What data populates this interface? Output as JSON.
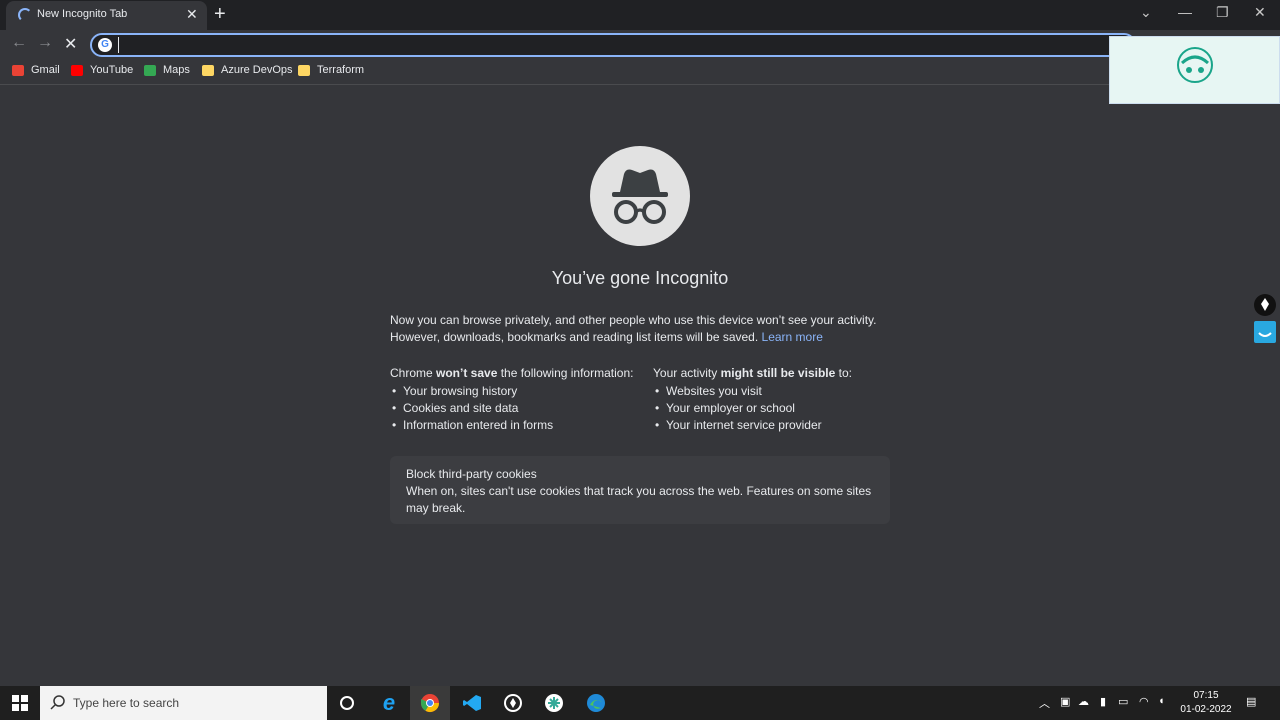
{
  "tab": {
    "title": "New Incognito Tab",
    "close": "✕"
  },
  "newtab": "+",
  "window": {
    "minimize": "—",
    "restore": "❐",
    "close": "✕",
    "tabsearch": "⌄"
  },
  "omnibox": {
    "value": "",
    "placeholder": ""
  },
  "bookmarks": [
    {
      "label": "Gmail",
      "color": "#ea4335"
    },
    {
      "label": "YouTube",
      "color": "#ff0000"
    },
    {
      "label": "Maps",
      "color": "#34a853"
    },
    {
      "label": "Azure DevOps",
      "color": "#fdd663"
    },
    {
      "label": "Terraform",
      "color": "#fdd663"
    }
  ],
  "content": {
    "heading": "You’ve gone Incognito",
    "para_line1": "Now you can browse privately, and other people who use this device won’t see your activity.",
    "para_line2": "However, downloads, bookmarks and reading list items will be saved.",
    "learn_more": "Learn more",
    "left_col": {
      "heading_a": "Chrome ",
      "heading_b": "won’t save",
      "heading_c": " the following information:",
      "items": [
        "Your browsing history",
        "Cookies and site data",
        "Information entered in forms"
      ]
    },
    "right_col": {
      "heading_a": "Your activity ",
      "heading_b": "might still be visible",
      "heading_c": " to:",
      "items": [
        "Websites you visit",
        "Your employer or school",
        "Your internet service provider"
      ]
    },
    "card": {
      "title": "Block third-party cookies",
      "body": "When on, sites can't use cookies that track you across the web. Features on some sites may break."
    }
  },
  "taskbar": {
    "search_placeholder": "Type here to search",
    "time": "07:15",
    "date": "01-02-2022"
  },
  "colors": {
    "accent": "#8ab4f8",
    "background": "#35363a",
    "titlebar": "#202124"
  }
}
